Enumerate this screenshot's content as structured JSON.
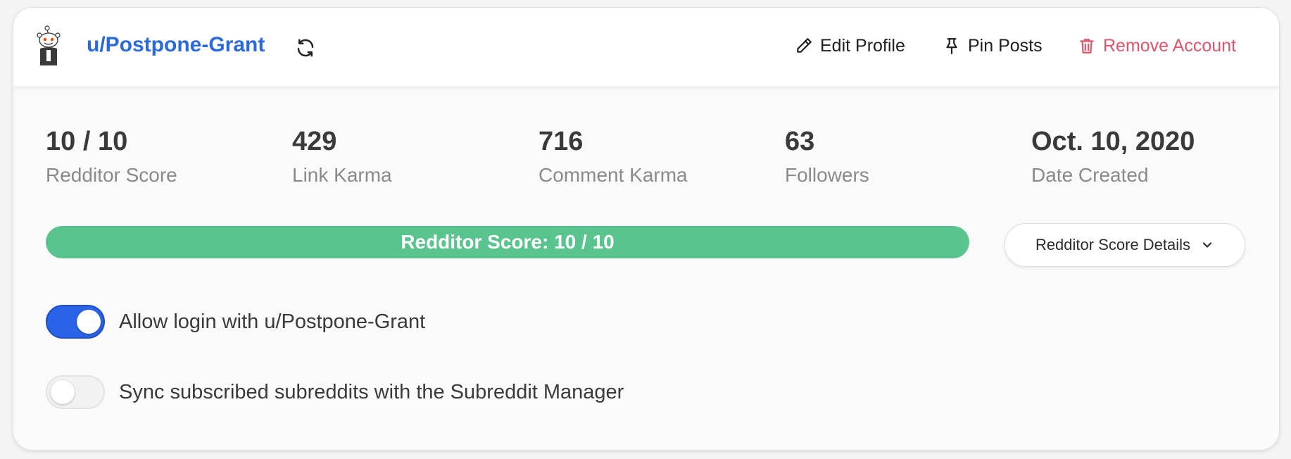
{
  "header": {
    "username": "u/Postpone-Grant",
    "actions": {
      "edit_profile": "Edit Profile",
      "pin_posts": "Pin Posts",
      "remove_account": "Remove Account"
    }
  },
  "stats": [
    {
      "value": "10 / 10",
      "label": "Redditor Score"
    },
    {
      "value": "429",
      "label": "Link Karma"
    },
    {
      "value": "716",
      "label": "Comment Karma"
    },
    {
      "value": "63",
      "label": "Followers"
    },
    {
      "value": "Oct. 10, 2020",
      "label": "Date Created"
    }
  ],
  "score_bar": {
    "text": "Redditor Score: 10 / 10",
    "fraction": 1.0
  },
  "details_button": "Redditor Score Details",
  "toggles": [
    {
      "label": "Allow login with u/Postpone-Grant",
      "on": true
    },
    {
      "label": "Sync subscribed subreddits with the Subreddit Manager",
      "on": false
    }
  ],
  "colors": {
    "accent": "#2a6ae0",
    "toggle_on": "#2a63e8",
    "progress": "#5ac48e",
    "danger": "#e0556b"
  },
  "icons": {
    "avatar": "reddit-snoo-avatar",
    "refresh": "refresh-icon",
    "edit": "pencil-icon",
    "pin": "pin-icon",
    "remove": "trash-icon",
    "dropdown": "chevron-down-icon"
  }
}
